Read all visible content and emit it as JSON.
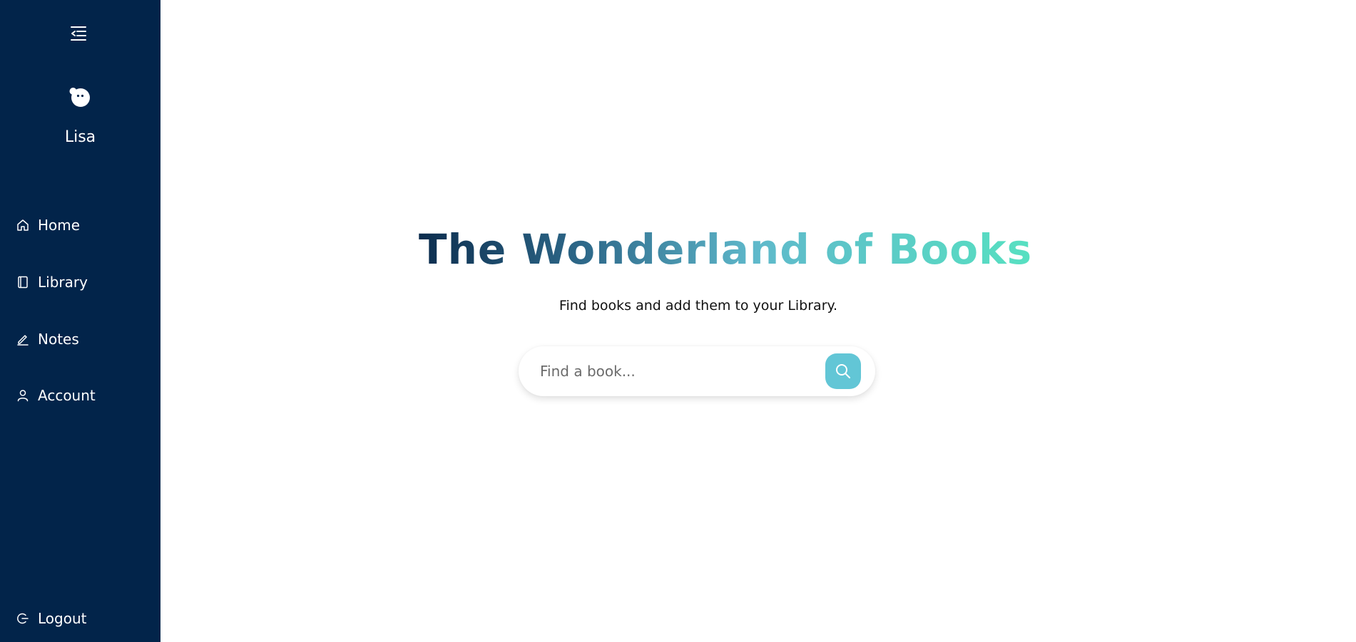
{
  "sidebar": {
    "user_name": "Lisa",
    "items": [
      {
        "label": "Home",
        "icon": "home-icon"
      },
      {
        "label": "Library",
        "icon": "book-icon"
      },
      {
        "label": "Notes",
        "icon": "pencil-icon"
      },
      {
        "label": "Account",
        "icon": "user-icon"
      }
    ],
    "logout_label": "Logout",
    "collapse_icon": "menu-collapse-icon",
    "avatar_icon": "avatar-icon"
  },
  "hero": {
    "title": "The Wonderland of Books",
    "subtitle": "Find books and add them to your Library."
  },
  "search": {
    "placeholder": "Find a book...",
    "value": "",
    "button_icon": "search-icon"
  },
  "colors": {
    "sidebar_bg": "#02244a",
    "accent": "#62c6d6",
    "title_gradient_start": "#0c2d4e",
    "title_gradient_end": "#57e0c1"
  }
}
